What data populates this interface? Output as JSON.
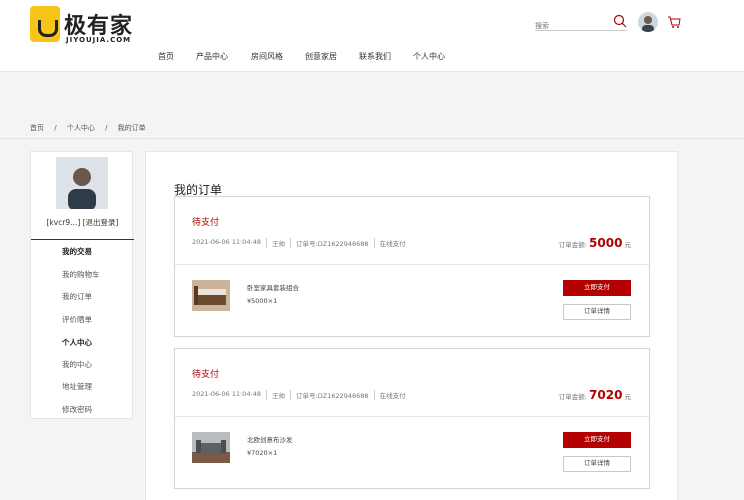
{
  "brand": {
    "name": "极有家",
    "sub": "JIYOUJIA.COM"
  },
  "nav": [
    "首页",
    "产品中心",
    "房间风格",
    "创意家居",
    "联系我们",
    "个人中心"
  ],
  "search": {
    "placeholder": "搜索"
  },
  "breadcrumb": [
    "首页",
    "/",
    "个人中心",
    "/",
    "我的订单"
  ],
  "sidebar": {
    "user_line": "[kvcr9...] [退出登录]",
    "items": [
      {
        "label": "我的交易",
        "head": true
      },
      {
        "label": "我的购物车",
        "head": false
      },
      {
        "label": "我的订单",
        "head": false
      },
      {
        "label": "评价晒单",
        "head": false
      },
      {
        "label": "个人中心",
        "head": true
      },
      {
        "label": "我的中心",
        "head": false
      },
      {
        "label": "地址管理",
        "head": false
      },
      {
        "label": "修改密码",
        "head": false
      }
    ]
  },
  "main": {
    "title": "我的订单"
  },
  "orders": [
    {
      "status": "待支付",
      "datetime": "2021-06-06 11:04:48",
      "recipient": "王帅",
      "order_no": "订单号:DZ1622948688",
      "payment": "在线支付",
      "total_label": "订单金额:",
      "total_amount": "5000",
      "total_unit": "元",
      "product_name": "卧室家具套装组合",
      "product_price": "¥5000×1",
      "pay_label": "立即支付",
      "detail_label": "订单详情",
      "img_color": "#8a6a4a"
    },
    {
      "status": "待支付",
      "datetime": "2021-06-06 11:04:48",
      "recipient": "王帅",
      "order_no": "订单号:DZ1622948688",
      "payment": "在线支付",
      "total_label": "订单金额:",
      "total_amount": "7020",
      "total_unit": "元",
      "product_name": "北欧创意布沙发",
      "product_price": "¥7020×1",
      "pay_label": "立即支付",
      "detail_label": "订单详情",
      "img_color": "#7d7f80"
    }
  ],
  "colors": {
    "accent": "#b30000",
    "logo": "#f5c518"
  }
}
